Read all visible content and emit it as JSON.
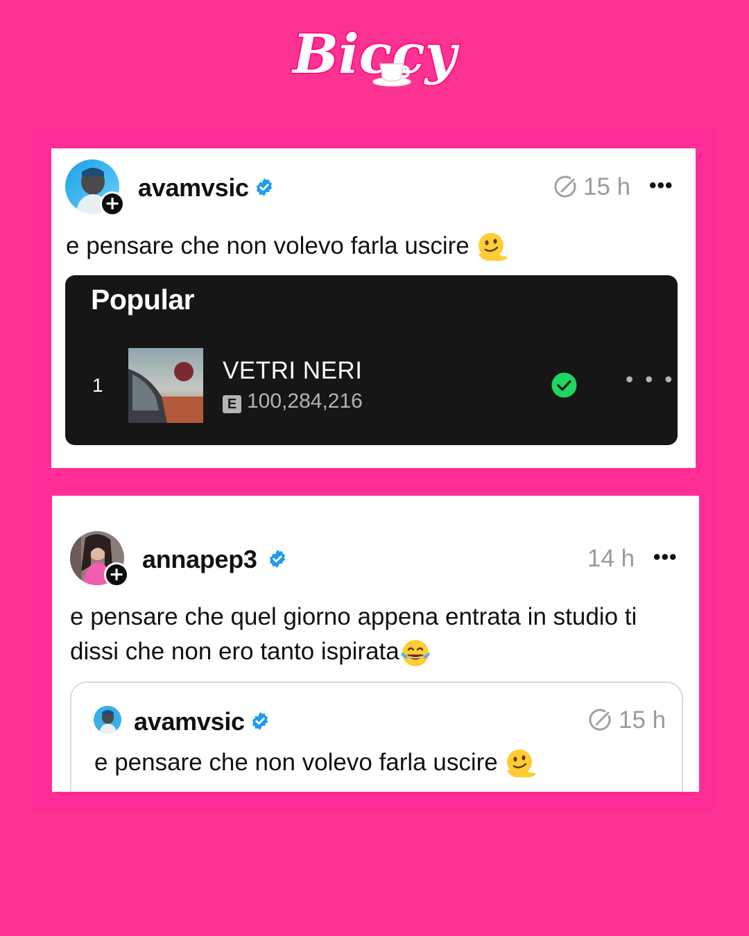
{
  "brand": {
    "logo_text": "Biccy",
    "pink": "#fd3393"
  },
  "post1": {
    "username": "avamvsic",
    "time": "15 h",
    "text": "e pensare che non volevo farla uscire",
    "more_label": "•••",
    "embed": {
      "title": "Popular",
      "rank": "1",
      "song": "VETRI NERI",
      "explicit": "E",
      "plays": "100,284,216",
      "more_label": "• • •"
    }
  },
  "post2": {
    "username": "annapep3",
    "time": "14 h",
    "text_line1": "e pensare che quel giorno appena entrata in studio ti",
    "text_line2": "dissi che non ero tanto ispirata",
    "more_label": "•••",
    "quote": {
      "username": "avamvsic",
      "time": "15 h",
      "text": "e pensare che non volevo farla uscire"
    }
  },
  "icons": [
    "verified-badge-icon",
    "edited-clock-icon",
    "more-icon",
    "follow-plus-icon",
    "melting-face-emoji",
    "tears-of-joy-emoji",
    "saved-check-icon",
    "teacup-icon"
  ]
}
